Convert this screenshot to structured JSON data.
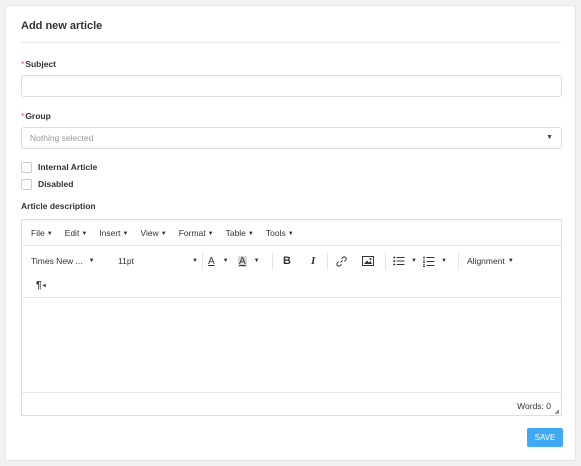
{
  "form": {
    "title": "Add new article",
    "required_marker": "*",
    "subject": {
      "label": "Subject",
      "value": ""
    },
    "group": {
      "label": "Group",
      "placeholder": "Nothing selected"
    },
    "internal_article": {
      "label": "Internal Article",
      "checked": false
    },
    "disabled": {
      "label": "Disabled",
      "checked": false
    },
    "description_label": "Article description",
    "save_label": "SAVE"
  },
  "editor": {
    "menus": [
      "File",
      "Edit",
      "Insert",
      "View",
      "Format",
      "Table",
      "Tools"
    ],
    "toolbar": {
      "font_family": "Times New ...",
      "font_size": "11pt",
      "text_color_glyph": "A",
      "background_color_glyph": "A",
      "bold": "B",
      "italic": "I",
      "alignment": "Alignment",
      "paragraph_glyph": "¶"
    },
    "words_label": "Words: 0"
  },
  "colors": {
    "accent": "#3fa9f5",
    "required": "#e2574c"
  }
}
